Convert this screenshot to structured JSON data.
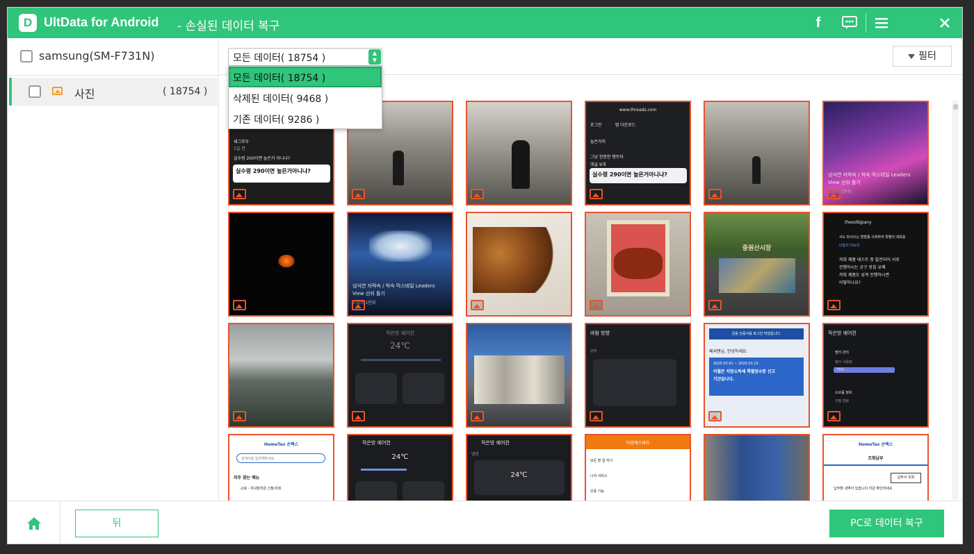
{
  "app": {
    "title": "UltData for Android",
    "subtitle": "- 손실된 데이터 복구",
    "logo_letter": "D",
    "accent": "#2fc57a"
  },
  "titlebar_icons": [
    "facebook-icon",
    "feedback-icon",
    "menu-icon",
    "close-icon"
  ],
  "sidebar": {
    "device": "samsung(SM-F731N)",
    "categories": [
      {
        "label": "사진",
        "count": "( 18754 )",
        "icon": "photo-icon"
      }
    ]
  },
  "filter_select": {
    "value": "모든 데이터( 18754 )",
    "options": [
      "모든 데이터( 18754 )",
      "삭제된 데이터( 9468 )",
      "기존 데이터( 9286 )"
    ]
  },
  "filter_button": "필터",
  "thumbs": {
    "t1_user": "새그로우",
    "t1_meta": "1일 전",
    "t1_text": "실수령 200이면 높은거 아니냐?",
    "t1_card": "실수령 290이면 높은거아니냐?",
    "t1_chip": "1만",
    "t4_url": "www.threads.com",
    "t4_tab1": "로그인",
    "t4_tab2": "앱 다운로드",
    "t4_line1": "높은거지",
    "t4_line2": "그냥 한증한 평트타",
    "t4_line3": "댓글 9개",
    "t4_card": "실수령 290이면 높은거아니냐?",
    "t6_caption": "넘식연 자락숙 / 착숙 믹스테일 Leaders View 선쉬 틀기",
    "t6_meta": "조회수 1만회",
    "t8_caption": "넘식연 자락숙 / 착숙 믹스테일 Leaders View 선쉬 틀기",
    "t8_meta": "조회수 1만회",
    "t11_sign": "중원산시장",
    "t12_handle": "thesolbjpany",
    "t12_line1": "서도 파서끄는 밤밤종 사회하여 특별의 대회를",
    "t12_line2": "더들리 어요리",
    "t12_line3": "저희 제품 테스트 중 발견되어 서로",
    "t12_line4": "진행하시는 공구 방침 유예",
    "t12_line5": "저희 제품도 성격 진행하시면",
    "t12_line6": "어떻하나요?",
    "t14_title": "작은방 에어컨",
    "t14_temp": "24℃",
    "t16_title": "바람 방향",
    "t16_sub": "상하",
    "t17_banner": "금융 인증서를 로그인 되었습니다.",
    "t17_hello": "페셔맨님, 안녕하세요.",
    "t17_date": "2025.03.01 ~ 2025.03.15",
    "t17_title": "이월은 지방소득세 특별징수분 신고 기간입니다.",
    "t18_title": "작은방 에어컨",
    "t18_row1": "필터 관리",
    "t18_row2": "필터 사용량",
    "t18_pct": "75%",
    "t18_row3": "소모품 정보",
    "t18_row4": "리필 알림",
    "t19_brand": "HomeTax 손택스",
    "t19_search": "검색어를 입력해주세요",
    "t19_section": "자주 찾는 메뉴",
    "t19_item": "근로 · 자녀장려금 신청/조회",
    "t20_title": "작은방 에어컨",
    "t20_temp": "24℃",
    "t21_title": "작은방 에어컨",
    "t21_mode": "냉방",
    "t21_temp": "24℃",
    "t22_title": "마음에스케치",
    "t22_row1": "모든 할 일 하기",
    "t22_row2": "나의 서비스",
    "t22_row3": "인증 기능",
    "t24_brand": "HomeTax 손택스",
    "t24_title": "조회납부",
    "t24_btn": "납부서 조회",
    "t24_text": "납부할 내역이 있습니다 지금 확인하세요"
  },
  "footer": {
    "back": "뒤",
    "recover": "PC로 데이터 복구"
  }
}
